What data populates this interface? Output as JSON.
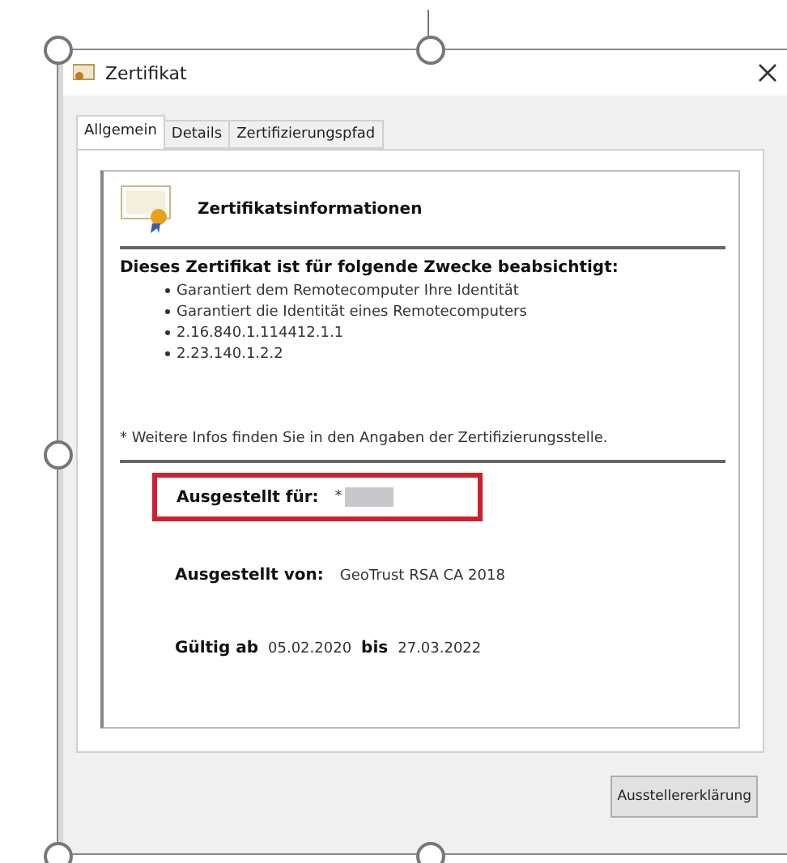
{
  "window": {
    "title": "Zertifikat"
  },
  "tabs": [
    {
      "label": "Allgemein",
      "selected": true
    },
    {
      "label": "Details",
      "selected": false
    },
    {
      "label": "Zertifizierungspfad",
      "selected": false
    }
  ],
  "panel": {
    "heading": "Zertifikatsinformationen",
    "purpose_title": "Dieses Zertifikat ist für folgende Zwecke beabsichtigt:",
    "purposes": [
      "Garantiert dem Remotecomputer Ihre Identität",
      "Garantiert die Identität eines Remotecomputers",
      "2.16.840.1.114412.1.1",
      "2.23.140.1.2.2"
    ],
    "note": "* Weitere Infos finden Sie in den Angaben der Zertifizierungsstelle.",
    "issued_to": {
      "label": "Ausgestellt für:",
      "value": "*",
      "highlighted": true
    },
    "issued_by": {
      "label": "Ausgestellt von:",
      "value": "GeoTrust RSA CA 2018"
    },
    "validity": {
      "from_label": "Gültig ab",
      "from": "05.02.2020",
      "to_label": "bis",
      "to": "27.03.2022"
    }
  },
  "buttons": [
    "Ausstellererklärung"
  ]
}
